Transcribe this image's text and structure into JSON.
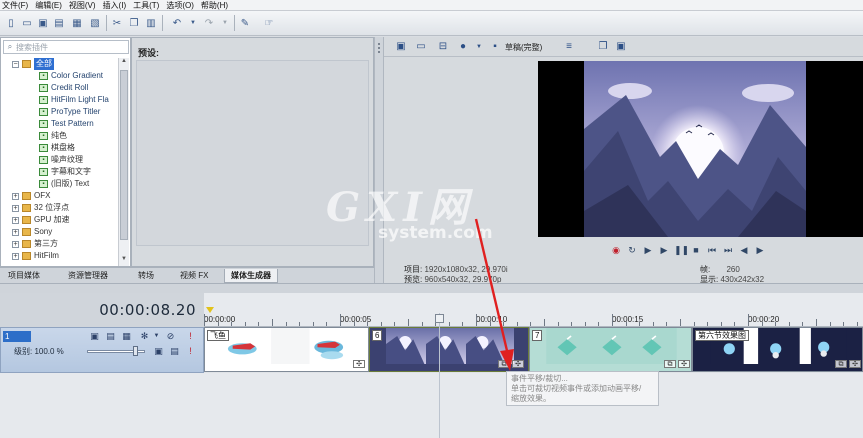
{
  "menu": [
    "文件(F)",
    "编辑(E)",
    "视图(V)",
    "插入(I)",
    "工具(T)",
    "选项(O)",
    "帮助(H)"
  ],
  "plugins": {
    "search_placeholder": "搜索插件",
    "tree": [
      {
        "label": "全部",
        "type": "folder",
        "expanded": true,
        "selected": true
      },
      {
        "label": "Color Gradient",
        "type": "fx"
      },
      {
        "label": "Credit Roll",
        "type": "fx"
      },
      {
        "label": "HitFilm Light Fla",
        "type": "fx"
      },
      {
        "label": "ProType Titler",
        "type": "fx"
      },
      {
        "label": "Test Pattern",
        "type": "fx"
      },
      {
        "label": "纯色",
        "type": "fx"
      },
      {
        "label": "棋盘格",
        "type": "fx"
      },
      {
        "label": "噪声纹理",
        "type": "fx"
      },
      {
        "label": "字幕和文字",
        "type": "fx"
      },
      {
        "label": "(旧版) Text",
        "type": "fx"
      },
      {
        "label": "OFX",
        "type": "folder"
      },
      {
        "label": "32 位浮点",
        "type": "folder"
      },
      {
        "label": "GPU 加速",
        "type": "folder"
      },
      {
        "label": "Sony",
        "type": "folder"
      },
      {
        "label": "第三方",
        "type": "folder"
      },
      {
        "label": "HitFilm",
        "type": "folder"
      }
    ]
  },
  "preset": {
    "label": "预设:"
  },
  "tabs": [
    "项目媒体",
    "资源管理器",
    "转场",
    "视频 FX",
    "媒体生成器"
  ],
  "active_tab": "媒体生成器",
  "preview": {
    "quality": "草稿(完整)",
    "project_label": "项目:",
    "project_value": "1920x1080x32, 29.970i",
    "preview_label": "预览:",
    "preview_value": "960x540x32, 29.970p",
    "frame_label": "帧:",
    "frame_value": "260",
    "display_label": "显示:",
    "display_value": "430x242x32"
  },
  "timeline": {
    "timecode": "00:00:08.20",
    "ruler": [
      "00:00:00",
      "00:00:05",
      "00:00:10",
      "00:00:15",
      "00:00:20"
    ],
    "track_number": "1",
    "level_label": "级别: 100.0 %",
    "clips": [
      {
        "label": "飞鱼"
      },
      {
        "label": "6"
      },
      {
        "label": "7"
      },
      {
        "label": "第六节效果图"
      }
    ]
  },
  "tooltip": [
    "事件平移/裁切...",
    "单击可裁切视频事件或添加动画平移/",
    "缩放效果。"
  ],
  "watermark": {
    "logo": "GXI网",
    "site": "system.com"
  },
  "colors": {
    "accent": "#2f6fd1",
    "arrow": "#e02020",
    "track_header": "#b4c7e0"
  }
}
